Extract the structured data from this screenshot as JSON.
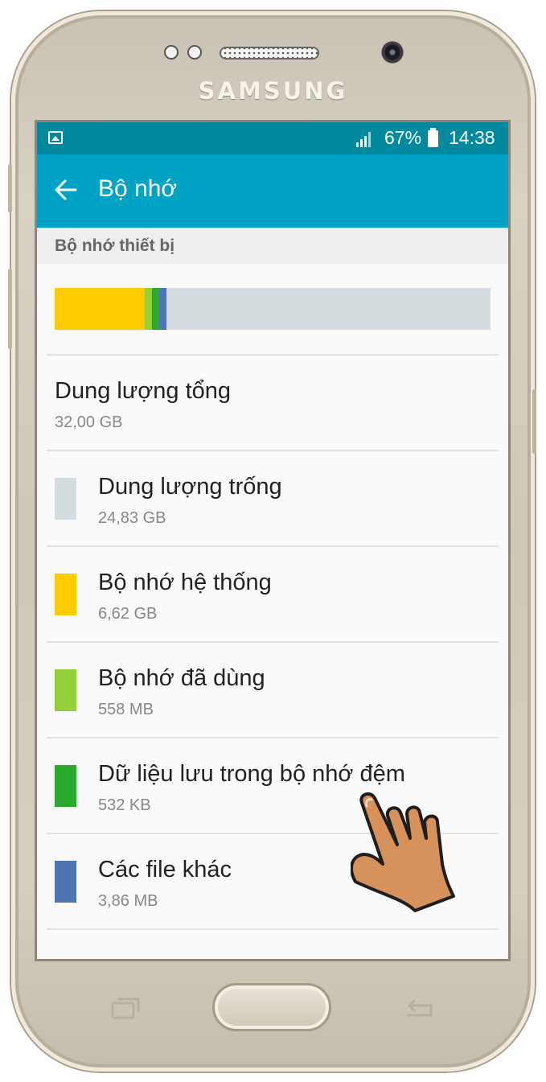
{
  "device": {
    "brand": "SAMSUNG"
  },
  "status_bar": {
    "battery_percent": "67%",
    "time": "14:38"
  },
  "app_bar": {
    "title": "Bộ nhớ"
  },
  "section_header": "Bộ nhớ thiết bị",
  "storage_bar": {
    "segments": [
      {
        "name": "Bộ nhớ hệ thống",
        "fraction": 0.207,
        "color": "#FECB00"
      },
      {
        "name": "Bộ nhớ đã dùng",
        "fraction": 0.017,
        "color": "#95CF3A"
      },
      {
        "name": "Dữ liệu lưu trong bộ nhớ đệm",
        "fraction": 0.016,
        "color": "#2BAA2E"
      },
      {
        "name": "Các file khác",
        "fraction": 0.017,
        "color": "#4F74B5"
      },
      {
        "name": "Dung lượng trống",
        "fraction": 0.743,
        "color": "#D3DCDE"
      }
    ]
  },
  "total": {
    "label": "Dung lượng tổng",
    "value": "32,00 GB"
  },
  "items": [
    {
      "label": "Dung lượng trống",
      "value": "24,83 GB",
      "color": "#D3DCDE"
    },
    {
      "label": "Bộ nhớ hệ thống",
      "value": "6,62 GB",
      "color": "#FECB00"
    },
    {
      "label": "Bộ nhớ đã dùng",
      "value": "558 MB",
      "color": "#95CF3A"
    },
    {
      "label": "Dữ liệu lưu trong bộ nhớ đệm",
      "value": "532 KB",
      "color": "#2BAA2E"
    },
    {
      "label": "Các file khác",
      "value": "3,86 MB",
      "color": "#4F74B5"
    }
  ],
  "icons": {
    "status_left": "gallery-icon",
    "signal": "signal-icon",
    "battery": "battery-icon",
    "back": "arrow-left-icon",
    "pointer": "hand-pointer-icon"
  }
}
